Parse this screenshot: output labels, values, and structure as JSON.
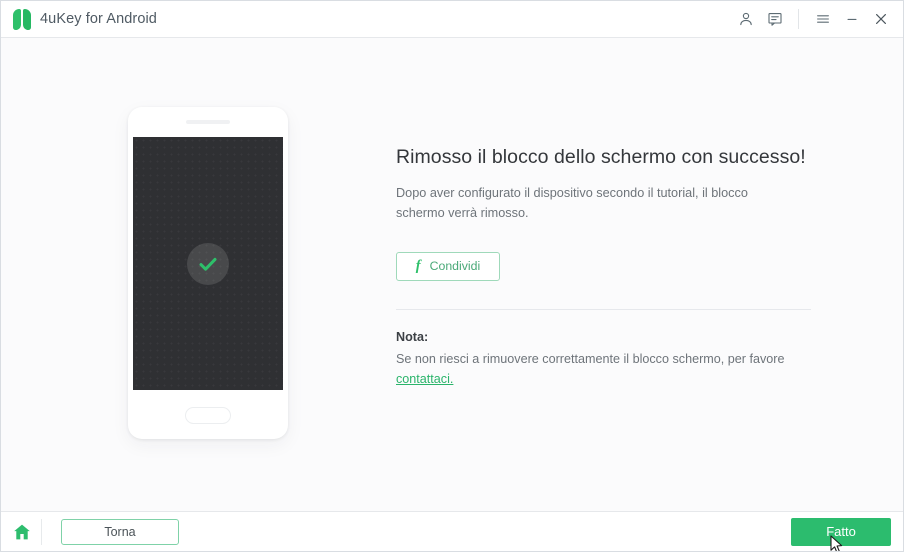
{
  "window": {
    "title": "4uKey for Android",
    "logo_icon": "leaf-logo-icon"
  },
  "titlebar": {
    "actions": [
      {
        "name": "account-icon",
        "label": "Account"
      },
      {
        "name": "feedback-icon",
        "label": "Feedback"
      },
      {
        "name": "menu-icon",
        "label": "Menu"
      },
      {
        "name": "minimize-icon",
        "label": "Minimize"
      },
      {
        "name": "close-icon",
        "label": "Close"
      }
    ]
  },
  "illustration": {
    "device": "android-phone",
    "status_icon": "check-mark-icon"
  },
  "main": {
    "headline": "Rimosso il blocco dello schermo con successo!",
    "description": "Dopo aver configurato il dispositivo secondo il tutorial, il blocco schermo verrà rimosso.",
    "share_button": "Condividi",
    "share_icon": "facebook-icon",
    "note_title": "Nota:",
    "note_body": "Se non riesci a rimuovere correttamente il blocco schermo, per favore",
    "note_link": "contattaci."
  },
  "footer": {
    "home_icon": "home-icon",
    "back_button": "Torna",
    "done_button": "Fatto"
  },
  "colors": {
    "accent_green": "#2cbc6e",
    "link_green": "#2bb46b",
    "screen_dark": "#2f3033",
    "text_primary": "#34373b",
    "text_secondary": "#6e747a"
  }
}
